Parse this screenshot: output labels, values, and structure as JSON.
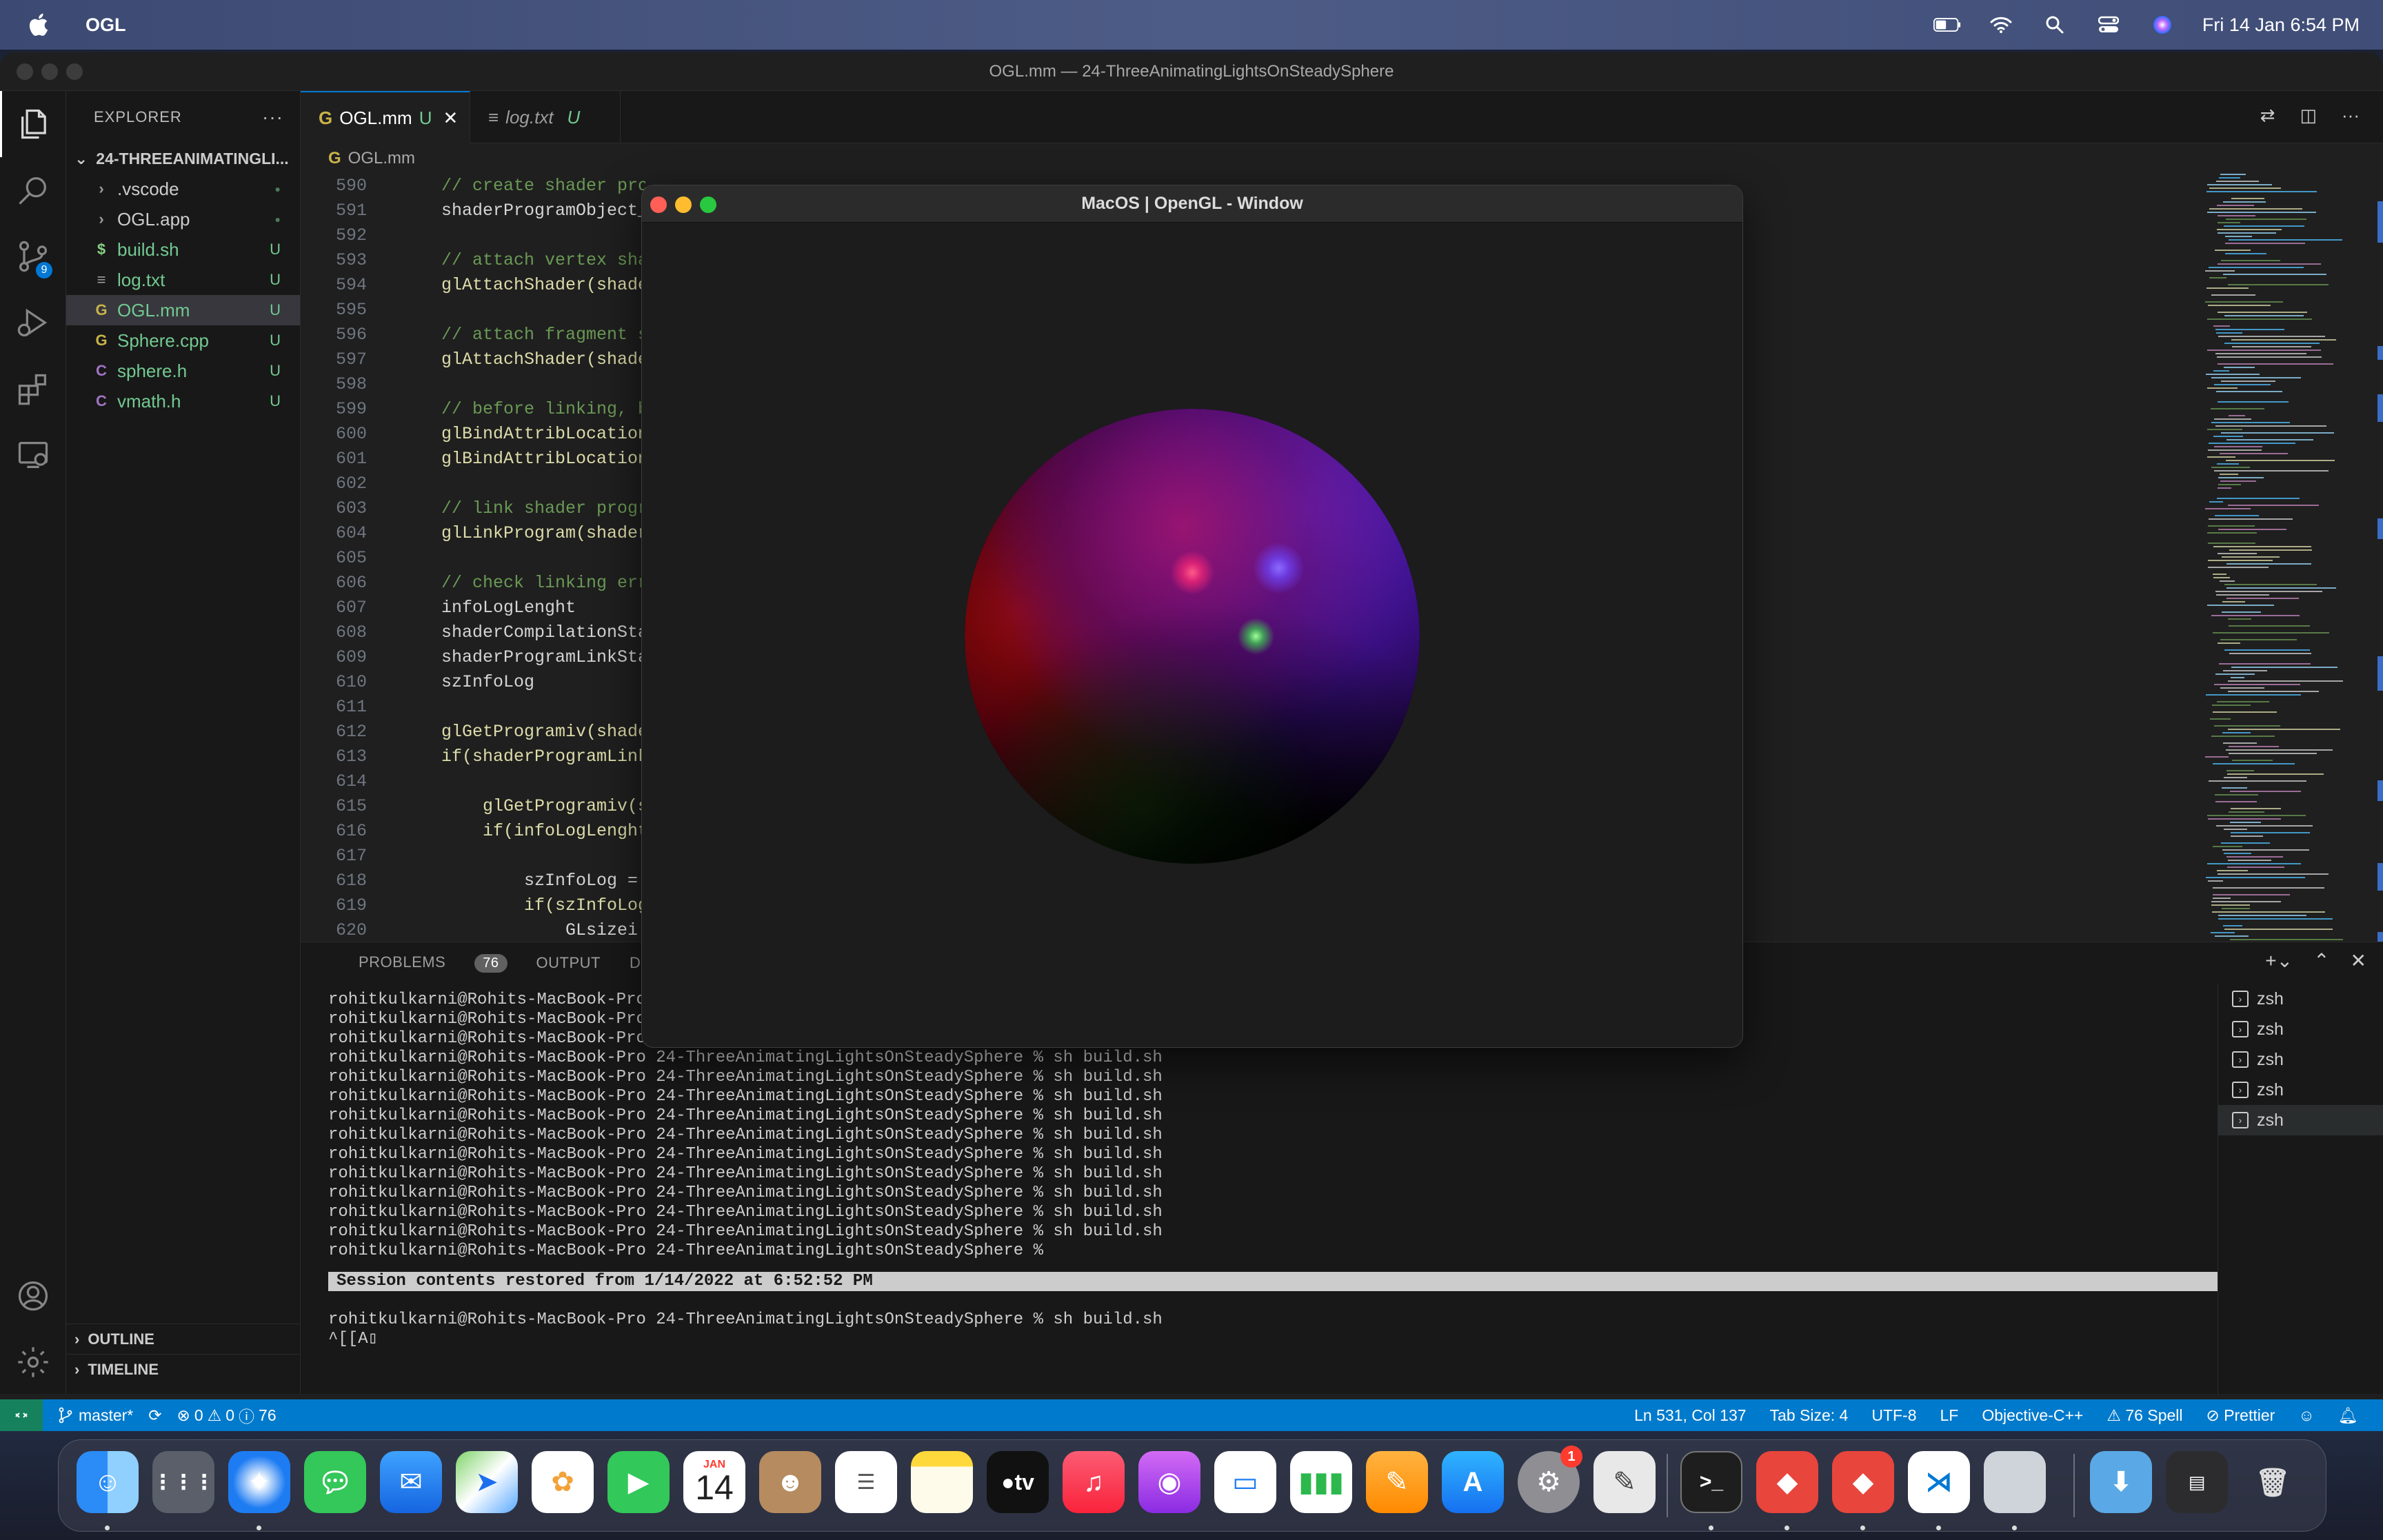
{
  "menubar": {
    "app_name": "OGL",
    "date_time": "Fri 14 Jan  6:54 PM"
  },
  "window": {
    "title": "OGL.mm — 24-ThreeAnimatingLightsOnSteadySphere"
  },
  "explorer": {
    "header": "EXPLORER",
    "folder": "24-THREEANIMATINGLI...",
    "files": [
      {
        "name": ".vscode",
        "icon": "chevron",
        "status": "●"
      },
      {
        "name": "OGL.app",
        "icon": "chevron",
        "status": "●"
      },
      {
        "name": "build.sh",
        "icon": "$",
        "status": "U"
      },
      {
        "name": "log.txt",
        "icon": "≡",
        "status": "U"
      },
      {
        "name": "OGL.mm",
        "icon": "G",
        "status": "U"
      },
      {
        "name": "Sphere.cpp",
        "icon": "G",
        "status": "U"
      },
      {
        "name": "sphere.h",
        "icon": "C",
        "status": "U"
      },
      {
        "name": "vmath.h",
        "icon": "C",
        "status": "U"
      }
    ],
    "outline": "OUTLINE",
    "timeline": "TIMELINE"
  },
  "tabs": [
    {
      "label": "OGL.mm",
      "status": "U"
    },
    {
      "label": "log.txt",
      "status": "U"
    }
  ],
  "breadcrumb": "OGL.mm",
  "scm_badge": "9",
  "code_lines": [
    {
      "n": "590",
      "t": "// create shader program object"
    },
    {
      "n": "591",
      "t": "shaderProgramObject_"
    },
    {
      "n": "592",
      "t": ""
    },
    {
      "n": "593",
      "t": "// attach vertex sha"
    },
    {
      "n": "594",
      "t": "glAttachShader(shade"
    },
    {
      "n": "595",
      "t": ""
    },
    {
      "n": "596",
      "t": "// attach fragment s"
    },
    {
      "n": "597",
      "t": "glAttachShader(shade"
    },
    {
      "n": "598",
      "t": ""
    },
    {
      "n": "599",
      "t": "// before linking, b"
    },
    {
      "n": "600",
      "t": "glBindAttribLocation"
    },
    {
      "n": "601",
      "t": "glBindAttribLocation"
    },
    {
      "n": "602",
      "t": ""
    },
    {
      "n": "603",
      "t": "// link shader progr"
    },
    {
      "n": "604",
      "t": "glLinkProgram(shader"
    },
    {
      "n": "605",
      "t": ""
    },
    {
      "n": "606",
      "t": "// check linking err"
    },
    {
      "n": "607",
      "t": "infoLogLenght"
    },
    {
      "n": "608",
      "t": "shaderCompilationSta"
    },
    {
      "n": "609",
      "t": "shaderProgramLinkSta"
    },
    {
      "n": "610",
      "t": "szInfoLog"
    },
    {
      "n": "611",
      "t": ""
    },
    {
      "n": "612",
      "t": "glGetProgramiv(shade"
    },
    {
      "n": "613",
      "t": "if(shaderProgramLink"
    },
    {
      "n": "614",
      "t": ""
    },
    {
      "n": "615",
      "t": "    glGetProgramiv(s"
    },
    {
      "n": "616",
      "t": "    if(infoLogLenght"
    },
    {
      "n": "617",
      "t": ""
    },
    {
      "n": "618",
      "t": "        szInfoLog ="
    },
    {
      "n": "619",
      "t": "        if(szInfoLog"
    },
    {
      "n": "620",
      "t": "            GLsizei"
    }
  ],
  "panel": {
    "tabs": [
      "PROBLEMS",
      "OUTPUT",
      "DEBUG"
    ],
    "problems_count": "76",
    "terminal_lines": [
      "rohitkulkarni@Rohits-MacBook-Pro",
      "rohitkulkarni@Rohits-MacBook-Pro",
      "rohitkulkarni@Rohits-MacBook-Pro",
      "rohitkulkarni@Rohits-MacBook-Pro 24-ThreeAnimatingLightsOnSteadySphere % sh build.sh",
      "rohitkulkarni@Rohits-MacBook-Pro 24-ThreeAnimatingLightsOnSteadySphere % sh build.sh",
      "rohitkulkarni@Rohits-MacBook-Pro 24-ThreeAnimatingLightsOnSteadySphere % sh build.sh",
      "rohitkulkarni@Rohits-MacBook-Pro 24-ThreeAnimatingLightsOnSteadySphere % sh build.sh",
      "rohitkulkarni@Rohits-MacBook-Pro 24-ThreeAnimatingLightsOnSteadySphere % sh build.sh",
      "rohitkulkarni@Rohits-MacBook-Pro 24-ThreeAnimatingLightsOnSteadySphere % sh build.sh",
      "rohitkulkarni@Rohits-MacBook-Pro 24-ThreeAnimatingLightsOnSteadySphere % sh build.sh",
      "rohitkulkarni@Rohits-MacBook-Pro 24-ThreeAnimatingLightsOnSteadySphere % sh build.sh",
      "rohitkulkarni@Rohits-MacBook-Pro 24-ThreeAnimatingLightsOnSteadySphere % sh build.sh",
      "rohitkulkarni@Rohits-MacBook-Pro 24-ThreeAnimatingLightsOnSteadySphere % sh build.sh",
      "rohitkulkarni@Rohits-MacBook-Pro 24-ThreeAnimatingLightsOnSteadySphere %"
    ],
    "restored": "Session contents restored from 1/14/2022 at 6:52:52 PM",
    "last_command": "rohitkulkarni@Rohits-MacBook-Pro 24-ThreeAnimatingLightsOnSteadySphere % sh build.sh",
    "input_line": "^[[A▯",
    "terminals": [
      "zsh",
      "zsh",
      "zsh",
      "zsh",
      "zsh"
    ]
  },
  "gl_window": {
    "title": "MacOS | OpenGL - Window"
  },
  "status": {
    "branch": "master*",
    "errors": "0",
    "warnings": "0",
    "infos": "76",
    "position": "Ln 531, Col 137",
    "tab_size": "Tab Size: 4",
    "encoding": "UTF-8",
    "eol": "LF",
    "language": "Objective-C++",
    "spell": "76 Spell",
    "prettier": "Prettier"
  },
  "dock": {
    "calendar_month": "JAN",
    "calendar_day": "14",
    "settings_badge": "1",
    "tv_label": "tv"
  },
  "colors": {
    "accent": "#0078d4",
    "status_bar": "#007acc",
    "untracked": "#73c991",
    "remote": "#16825d"
  }
}
